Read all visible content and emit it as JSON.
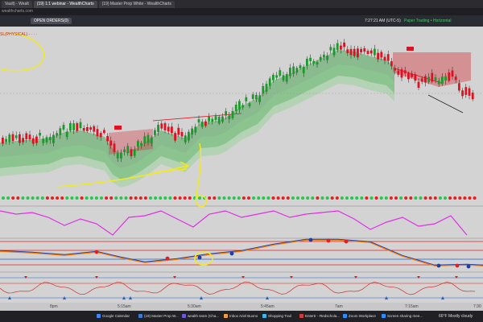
{
  "browser": {
    "tabs": [
      {
        "label": "Vault) - Wealt",
        "active": false
      },
      {
        "label": "(19) 1:1 webinar - WealthCharts",
        "active": true
      },
      {
        "label": "(19) Master Prop White - WealthCharts",
        "active": false
      }
    ],
    "address": "wealthcharts.com"
  },
  "toolbar": {
    "open_orders_label": "OPEN ORDERS(0)",
    "clock": "7:27:21 AM  (UTC-5)",
    "paper_trading": "Paper Trading  •  Horizontal"
  },
  "indicator_label": "SL(PHYSICAL)  -  ·  ·  ·",
  "colors": {
    "background": "#d3d3d3",
    "up_candle": "#1a9a2a",
    "down_candle": "#e01020",
    "band_green": "#2f9e3a",
    "band_red": "#d43038",
    "annotation": "#f2ea1c",
    "oscillator": "#e02ee8"
  },
  "time_axis": [
    "8pm",
    "5:15am",
    "5:30am",
    "5:45am",
    "7am",
    "7:15am",
    "7:30"
  ],
  "taskbar": {
    "items": [
      {
        "label": "Google Calendar",
        "color": "#4285f4"
      },
      {
        "label": "(19) Master Prop W...",
        "color": "#3a7bd5"
      },
      {
        "label": "wealth team (Cha...",
        "color": "#6b5bd5"
      },
      {
        "label": "Inbox Ariel Buono",
        "color": "#e9a23b"
      },
      {
        "label": "Shopping Trail",
        "color": "#3bb6e9"
      },
      {
        "label": "Entertr - #tedschola...",
        "color": "#d53a3a"
      },
      {
        "label": "Zoom Workplace",
        "color": "#2d8cff"
      },
      {
        "label": "Screen sharing mee...",
        "color": "#2d8cff"
      }
    ],
    "weather": "66°F  Mostly cloudy"
  }
}
